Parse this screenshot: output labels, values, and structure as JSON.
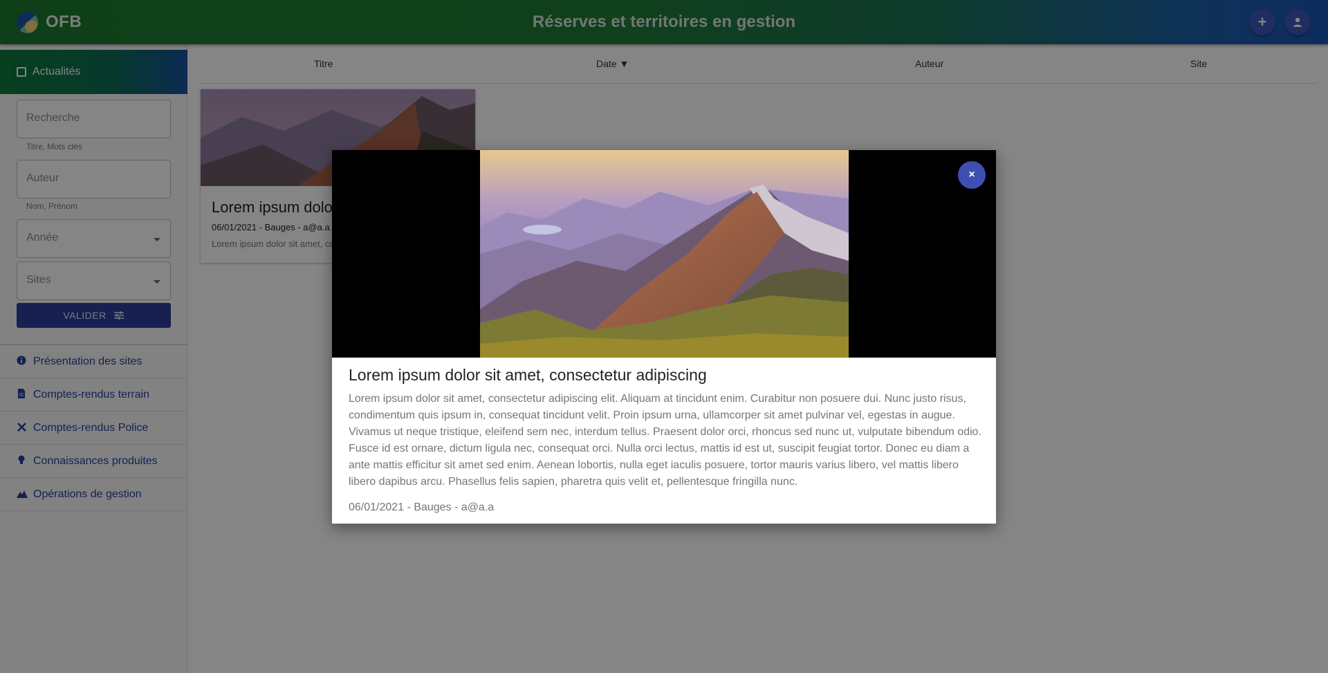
{
  "header": {
    "brand": "OFB",
    "title": "Réserves et territoires en gestion",
    "add_icon": "+",
    "account_icon": "person-icon"
  },
  "sidebar": {
    "active_item": "Actualités",
    "search": {
      "placeholder": "Recherche",
      "hint": "Titre, Mots clés"
    },
    "author": {
      "placeholder": "Auteur",
      "hint": "Nom, Prénom"
    },
    "year": {
      "placeholder": "Année"
    },
    "sites": {
      "placeholder": "Sites"
    },
    "validate_label": "VALIDER",
    "nav": [
      {
        "label": "Présentation des sites",
        "icon": "info-icon"
      },
      {
        "label": "Comptes-rendus terrain",
        "icon": "document-icon"
      },
      {
        "label": "Comptes-rendus Police",
        "icon": "tools-icon"
      },
      {
        "label": "Connaissances produites",
        "icon": "lightbulb-icon"
      },
      {
        "label": "Opérations de gestion",
        "icon": "mountain-icon"
      }
    ]
  },
  "table": {
    "columns": [
      "Titre",
      "Date ▼",
      "Auteur",
      "Site"
    ]
  },
  "card": {
    "title": "Lorem ipsum dolor sit amet, consectetur adipiscing",
    "meta": "06/01/2021 - Bauges - a@a.a",
    "excerpt": "Lorem ipsum dolor sit amet, consectetur adipiscing elit."
  },
  "modal": {
    "close_label": "×",
    "title": "Lorem ipsum dolor sit amet, consectetur adipiscing",
    "body": "Lorem ipsum dolor sit amet, consectetur adipiscing elit. Aliquam at tincidunt enim. Curabitur non posuere dui. Nunc justo risus, condimentum quis ipsum in, consequat tincidunt velit. Proin ipsum urna, ullamcorper sit amet pulvinar vel, egestas in augue. Vivamus ut neque tristique, eleifend sem nec, interdum tellus. Praesent dolor orci, rhoncus sed nunc ut, vulputate bibendum odio. Fusce id est ornare, dictum ligula nec, consequat orci. Nulla orci lectus, mattis id est ut, suscipit feugiat tortor. Donec eu diam a ante mattis efficitur sit amet sed enim. Aenean lobortis, nulla eget iaculis posuere, tortor mauris varius libero, vel mattis libero libero dapibus arcu. Phasellus felis sapien, pharetra quis velit et, pellentesque fringilla nunc.",
    "meta": "06/01/2021 - Bauges - a@a.a"
  },
  "colors": {
    "primary": "#2f3e9e",
    "header_green": "#1e7a2e",
    "header_blue": "#1a54b6"
  }
}
